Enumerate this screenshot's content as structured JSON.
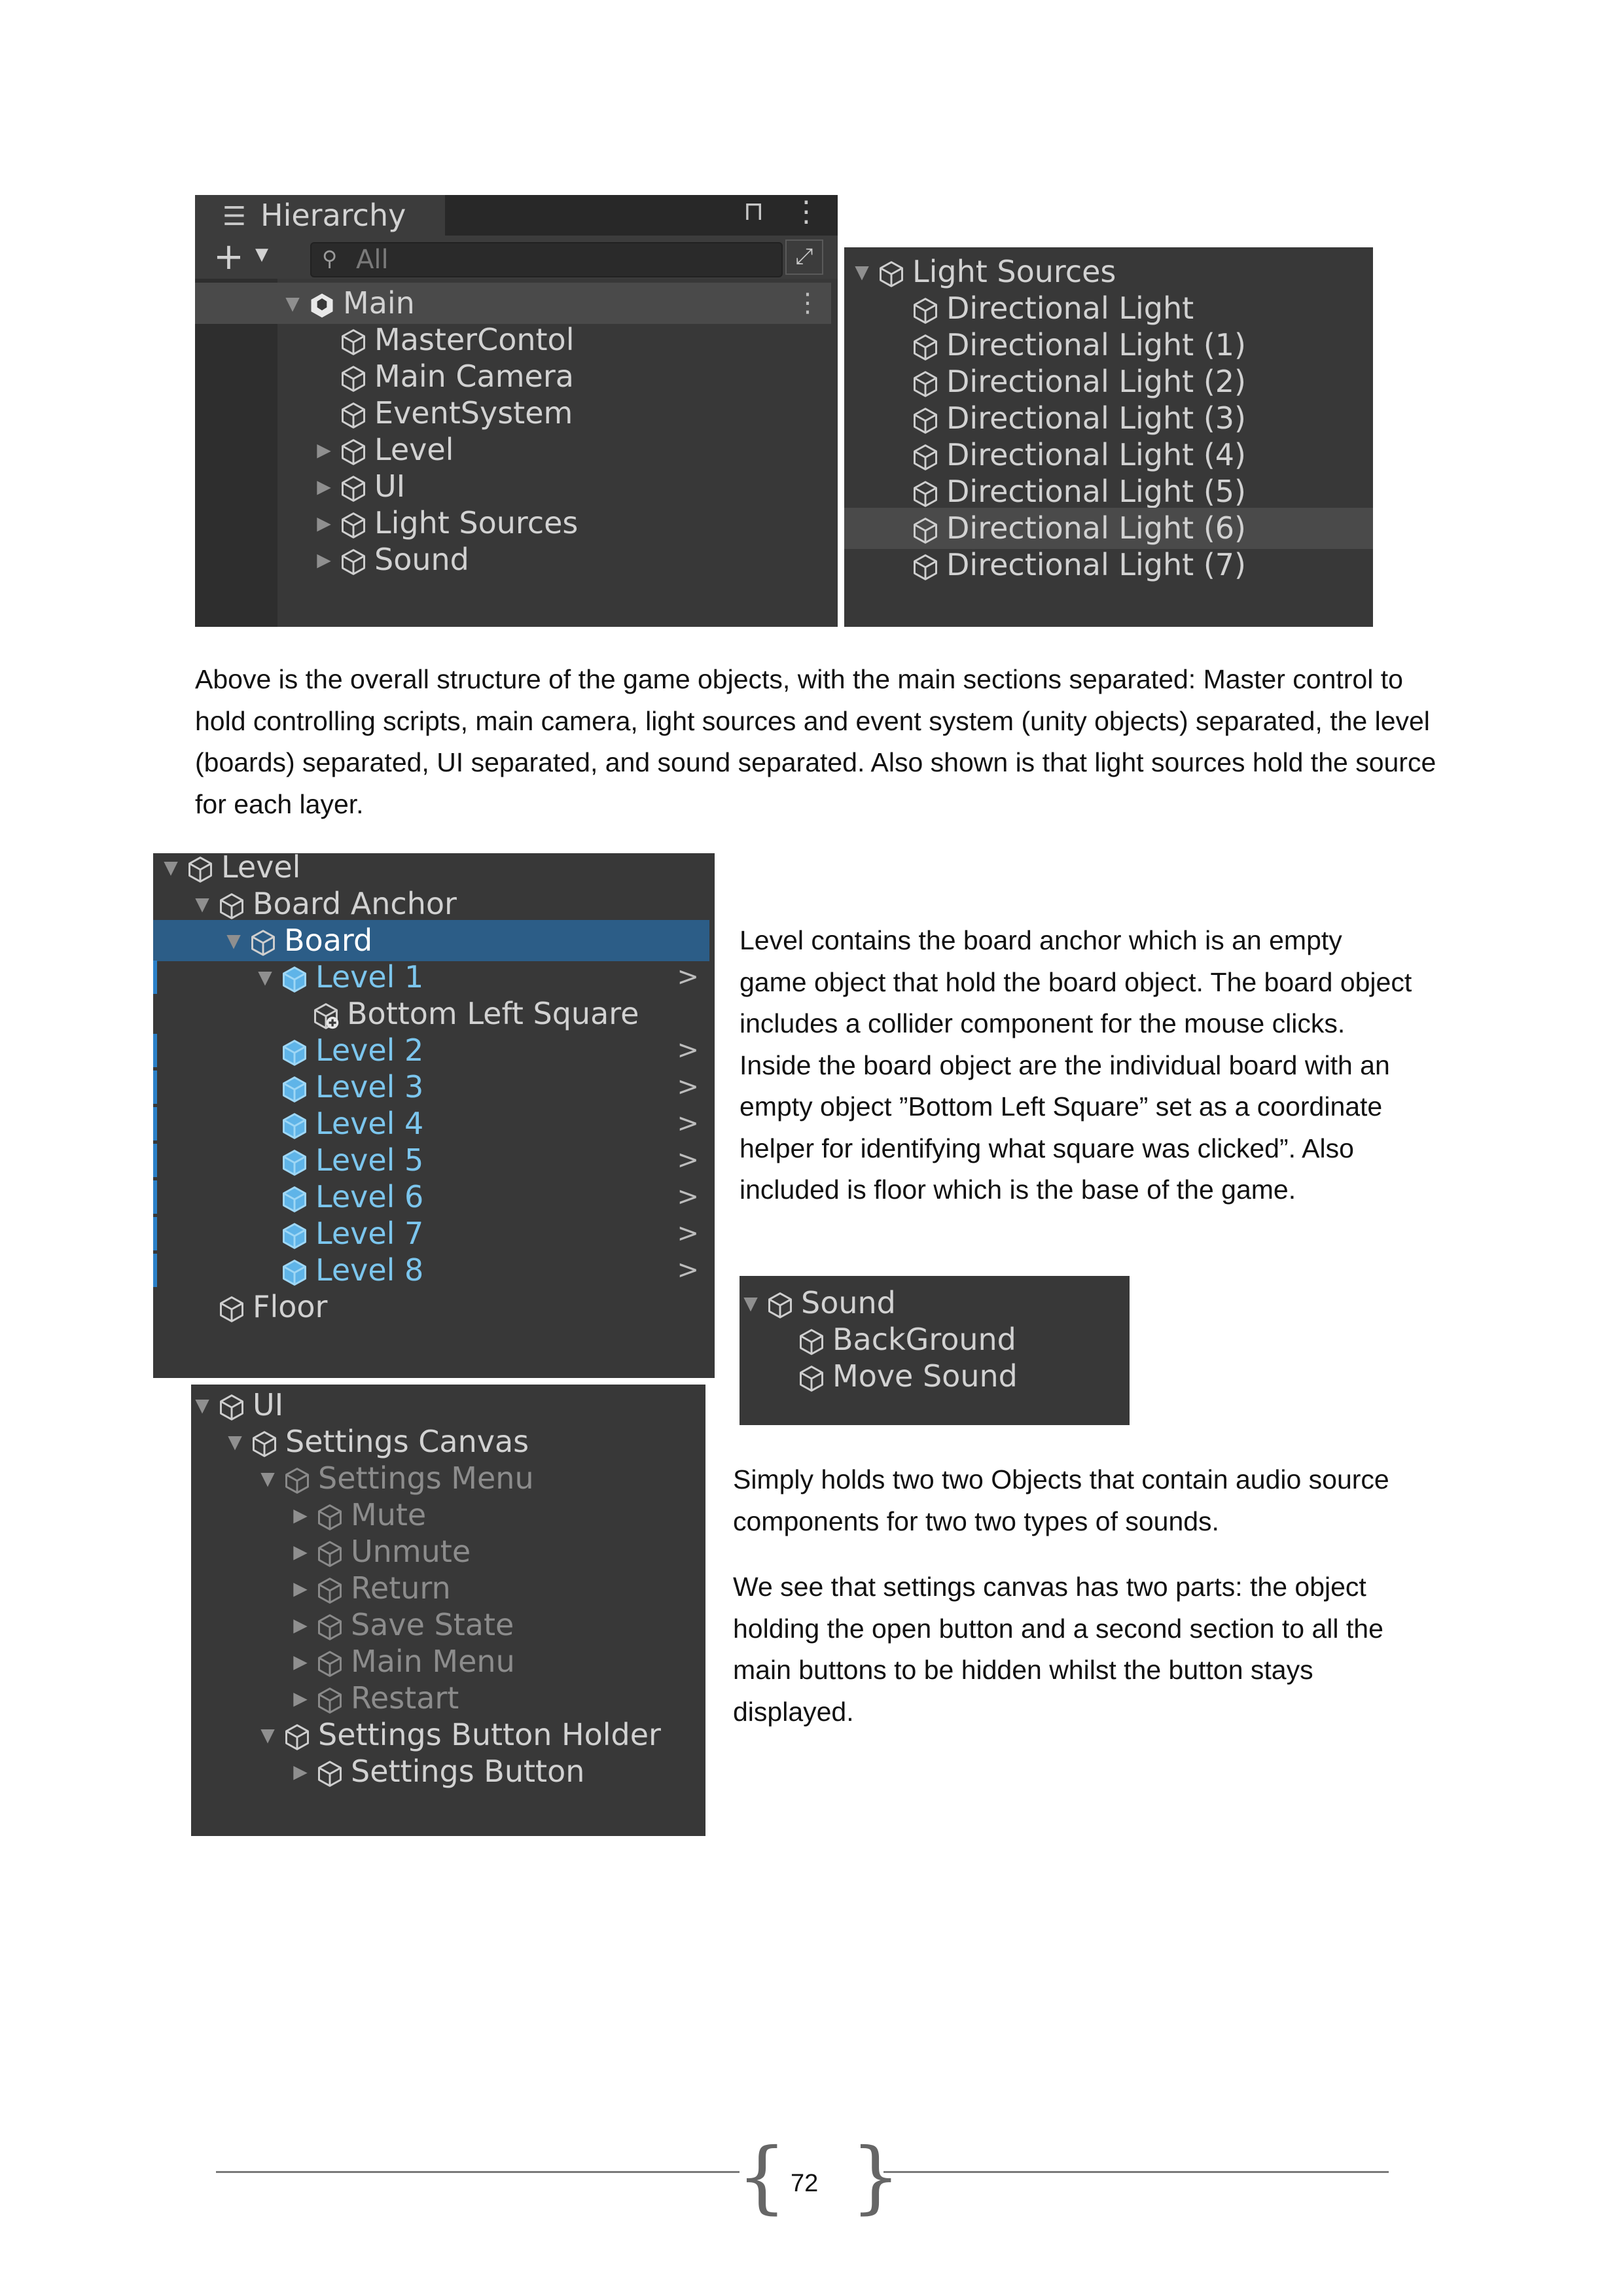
{
  "hierarchy_panel": {
    "title": "Hierarchy",
    "search_placeholder": "All",
    "add_label": "+",
    "rows": [
      {
        "label": "Main",
        "indent": 0,
        "arrow": "down",
        "icon": "unity-scene-icon",
        "kind": "scene",
        "highlight": true,
        "menu": true
      },
      {
        "label": "MasterContol",
        "indent": 1,
        "arrow": "",
        "icon": "cube-icon"
      },
      {
        "label": "Main Camera",
        "indent": 1,
        "arrow": "",
        "icon": "cube-icon"
      },
      {
        "label": "EventSystem",
        "indent": 1,
        "arrow": "",
        "icon": "cube-icon"
      },
      {
        "label": "Level",
        "indent": 1,
        "arrow": "right",
        "icon": "cube-icon"
      },
      {
        "label": "UI",
        "indent": 1,
        "arrow": "right",
        "icon": "cube-icon"
      },
      {
        "label": "Light Sources",
        "indent": 1,
        "arrow": "right",
        "icon": "cube-icon"
      },
      {
        "label": "Sound",
        "indent": 1,
        "arrow": "right",
        "icon": "cube-icon"
      }
    ]
  },
  "light_sources_panel": {
    "rows": [
      {
        "label": "Light Sources",
        "indent": 0,
        "arrow": "down"
      },
      {
        "label": "Directional Light",
        "indent": 1,
        "arrow": ""
      },
      {
        "label": "Directional Light (1)",
        "indent": 1,
        "arrow": ""
      },
      {
        "label": "Directional Light (2)",
        "indent": 1,
        "arrow": ""
      },
      {
        "label": "Directional Light (3)",
        "indent": 1,
        "arrow": ""
      },
      {
        "label": "Directional Light (4)",
        "indent": 1,
        "arrow": ""
      },
      {
        "label": "Directional Light (5)",
        "indent": 1,
        "arrow": ""
      },
      {
        "label": "Directional Light (6)",
        "indent": 1,
        "arrow": "",
        "highlight": true
      },
      {
        "label": "Directional Light (7)",
        "indent": 1,
        "arrow": ""
      }
    ]
  },
  "paragraph_1": "Above is the overall structure of the game objects, with the main sections separated: Master control to hold controlling scripts, main camera, light sources and event system (unity objects) separated, the level (boards) separated, UI separated, and sound separated. Also shown is that light sources hold the source for each layer.",
  "level_panel": {
    "rows": [
      {
        "label": "Level",
        "indent": 0,
        "arrow": "down"
      },
      {
        "label": "Board Anchor",
        "indent": 1,
        "arrow": "down"
      },
      {
        "label": "Board",
        "indent": 2,
        "arrow": "down",
        "selected": true
      },
      {
        "label": "Level 1",
        "indent": 3,
        "arrow": "down",
        "prefab": true,
        "chevron": ">"
      },
      {
        "label": "Bottom Left Square",
        "indent": 4,
        "arrow": "",
        "icon": "cube-add-icon"
      },
      {
        "label": "Level 2",
        "indent": 3,
        "arrow": "",
        "prefab": true,
        "chevron": ">"
      },
      {
        "label": "Level 3",
        "indent": 3,
        "arrow": "",
        "prefab": true,
        "chevron": ">"
      },
      {
        "label": "Level 4",
        "indent": 3,
        "arrow": "",
        "prefab": true,
        "chevron": ">"
      },
      {
        "label": "Level 5",
        "indent": 3,
        "arrow": "",
        "prefab": true,
        "chevron": ">"
      },
      {
        "label": "Level 6",
        "indent": 3,
        "arrow": "",
        "prefab": true,
        "chevron": ">"
      },
      {
        "label": "Level 7",
        "indent": 3,
        "arrow": "",
        "prefab": true,
        "chevron": ">"
      },
      {
        "label": "Level 8",
        "indent": 3,
        "arrow": "",
        "prefab": true,
        "chevron": ">"
      },
      {
        "label": "Floor",
        "indent": 1,
        "arrow": ""
      }
    ]
  },
  "paragraph_2": "Level contains the board anchor which is an empty game object that hold the board object. The board object includes a collider component for the mouse clicks. Inside the board object are the individual board with an empty object ”Bottom Left Square” set as a coordinate helper for identifying what square was clicked”. Also included is floor which is the base of the game.",
  "sound_panel": {
    "rows": [
      {
        "label": "Sound",
        "indent": 0,
        "arrow": "down"
      },
      {
        "label": "BackGround",
        "indent": 1,
        "arrow": ""
      },
      {
        "label": "Move Sound",
        "indent": 1,
        "arrow": ""
      }
    ]
  },
  "ui_panel": {
    "rows": [
      {
        "label": "UI",
        "indent": 0,
        "arrow": "down"
      },
      {
        "label": "Settings Canvas",
        "indent": 1,
        "arrow": "down"
      },
      {
        "label": "Settings Menu",
        "indent": 2,
        "arrow": "down",
        "dim": true
      },
      {
        "label": "Mute",
        "indent": 3,
        "arrow": "right",
        "dim": true
      },
      {
        "label": "Unmute",
        "indent": 3,
        "arrow": "right",
        "dim": true
      },
      {
        "label": "Return",
        "indent": 3,
        "arrow": "right",
        "dim": true
      },
      {
        "label": "Save State",
        "indent": 3,
        "arrow": "right",
        "dim": true
      },
      {
        "label": "Main Menu",
        "indent": 3,
        "arrow": "right",
        "dim": true
      },
      {
        "label": "Restart",
        "indent": 3,
        "arrow": "right",
        "dim": true
      },
      {
        "label": "Settings Button Holder",
        "indent": 2,
        "arrow": "down"
      },
      {
        "label": "Settings Button",
        "indent": 3,
        "arrow": "right"
      }
    ]
  },
  "paragraph_3": "Simply holds two two Objects that contain audio source components for two two types of sounds.",
  "paragraph_4": "We see that settings canvas has two parts: the object holding the open button and a second section to all the main buttons to be hidden whilst the button stays displayed.",
  "page_number": "72"
}
